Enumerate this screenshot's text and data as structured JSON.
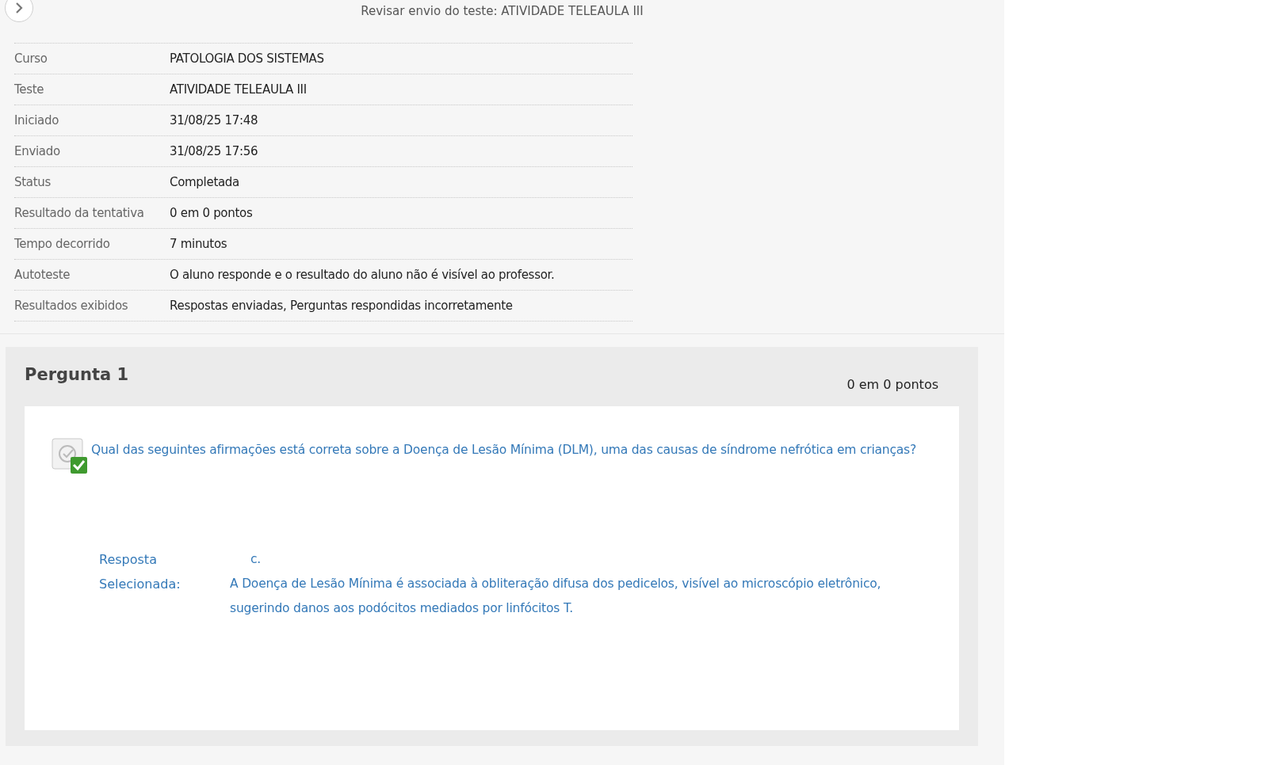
{
  "header": {
    "title": "Revisar envio do teste: ATIVIDADE TELEAULA III"
  },
  "details": [
    {
      "label": "Curso",
      "value": "PATOLOGIA DOS SISTEMAS"
    },
    {
      "label": "Teste",
      "value": "ATIVIDADE TELEAULA III"
    },
    {
      "label": "Iniciado",
      "value": "31/08/25 17:48"
    },
    {
      "label": "Enviado",
      "value": "31/08/25 17:56"
    },
    {
      "label": "Status",
      "value": "Completada"
    },
    {
      "label": "Resultado da tentativa",
      "value": "0 em 0 pontos"
    },
    {
      "label": "Tempo decorrido",
      "value": "7 minutos"
    },
    {
      "label": "Autoteste",
      "value": "O aluno responde e o resultado do aluno não é visível ao professor."
    },
    {
      "label": "Resultados exibidos",
      "value": "Respostas enviadas, Perguntas respondidas incorretamente"
    }
  ],
  "question": {
    "title": "Pergunta 1",
    "points": "0 em 0 pontos",
    "text": "Qual das seguintes afirmações está correta sobre a Doença de Lesão Mínima (DLM), uma das causas de síndrome nefrótica em crianças?",
    "answer_label_1": "Resposta",
    "answer_label_2": "Selecionada:",
    "answer_letter": "c.",
    "answer_text": "A Doença de Lesão Mínima é associada à obliteração difusa dos pedicelos, visível ao microscópio eletrônico, sugerindo danos aos podócitos mediados por linfócitos T."
  }
}
